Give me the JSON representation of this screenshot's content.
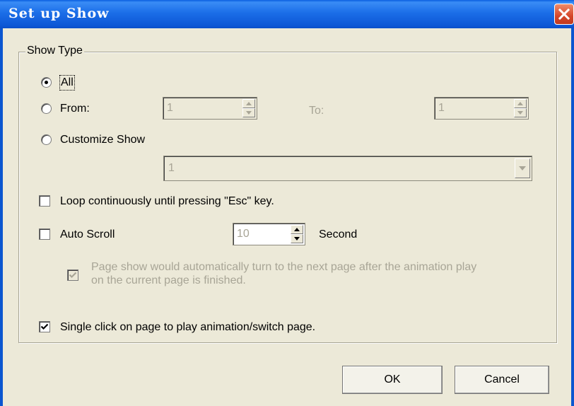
{
  "window": {
    "title": "Set up Show"
  },
  "show_type": {
    "legend": "Show Type",
    "all_label": "All",
    "from_label": "From:",
    "from_value": "1",
    "to_label": "To:",
    "to_value": "1",
    "customize_label": "Customize Show",
    "customize_value": "1",
    "selected": "All"
  },
  "options": {
    "loop_label": "Loop continuously until pressing \"Esc\" key.",
    "loop_checked": false,
    "auto_scroll_label": "Auto Scroll",
    "auto_scroll_checked": false,
    "auto_scroll_value": "10",
    "auto_scroll_unit": "Second",
    "auto_turn_line1": "Page show would automatically turn to the next page after the animation play",
    "auto_turn_line2": "on the current page is finished.",
    "auto_turn_checked": true,
    "single_click_label": "Single click on page to play animation/switch page.",
    "single_click_checked": true
  },
  "buttons": {
    "ok_label": "OK",
    "cancel_label": "Cancel"
  }
}
